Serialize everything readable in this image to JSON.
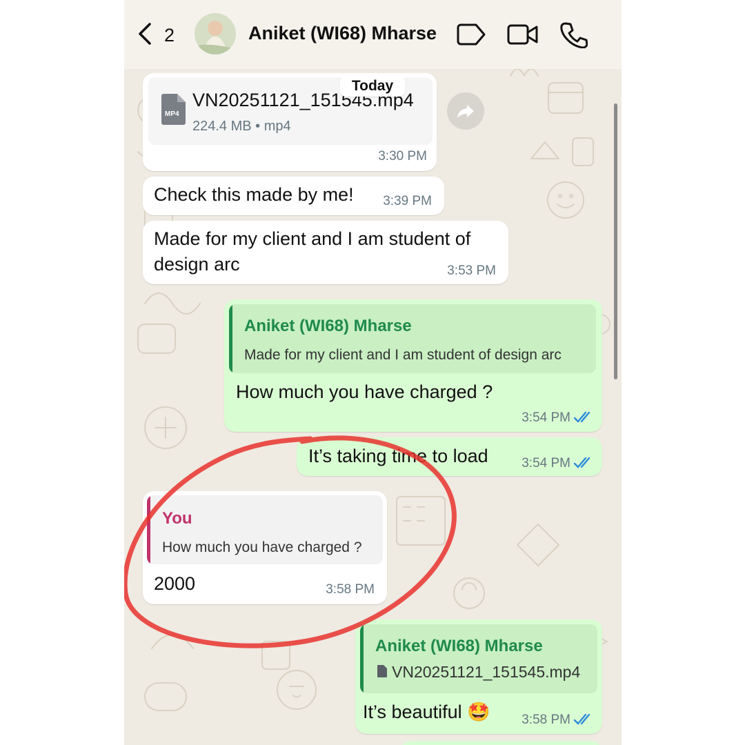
{
  "header": {
    "back_count": "2",
    "contact_name": "Aniket (WI68) Mharse",
    "icons": [
      "chevron-left-icon",
      "label-tag-icon",
      "video-call-icon",
      "phone-call-icon"
    ]
  },
  "date_chip": "Today",
  "messages": [
    {
      "type": "file",
      "direction": "incoming",
      "file_badge": "MP4",
      "file_name": "VN20251121_151545.mp4",
      "file_meta": "224.4 MB • mp4",
      "time": "3:30 PM",
      "forward_icon": "forward-arrow-icon"
    },
    {
      "type": "text",
      "direction": "incoming",
      "text": "Check this made by me!",
      "time": "3:39 PM"
    },
    {
      "type": "text",
      "direction": "incoming",
      "text": "Made for my client and I am student of design arc",
      "time": "3:53 PM"
    },
    {
      "type": "reply",
      "direction": "outgoing",
      "quote_author": "Aniket (WI68) Mharse",
      "quote_text": "Made for my client and I am student of design arc",
      "text": "How much you have charged ?",
      "time": "3:54 PM",
      "status": "read"
    },
    {
      "type": "text",
      "direction": "outgoing",
      "text": "It’s taking time to load",
      "time": "3:54 PM",
      "status": "read"
    },
    {
      "type": "reply",
      "direction": "incoming",
      "quote_author": "You",
      "quote_text": "How much you have charged ?",
      "text": "2000",
      "time": "3:58 PM"
    },
    {
      "type": "reply",
      "direction": "outgoing",
      "quote_author": "Aniket (WI68) Mharse",
      "quote_text": "VN20251121_151545.mp4",
      "text": "It’s beautiful 🤩",
      "time": "3:58 PM",
      "status": "read"
    }
  ],
  "colors": {
    "outgoing_bubble": "#d9fdd3",
    "incoming_bubble": "#ffffff",
    "chat_background": "#efeae2",
    "quote_green": "#1f8a4c",
    "quote_pink": "#c0336b",
    "read_ticks": "#2a8bd9",
    "annotation_circle": "#e8322e"
  }
}
